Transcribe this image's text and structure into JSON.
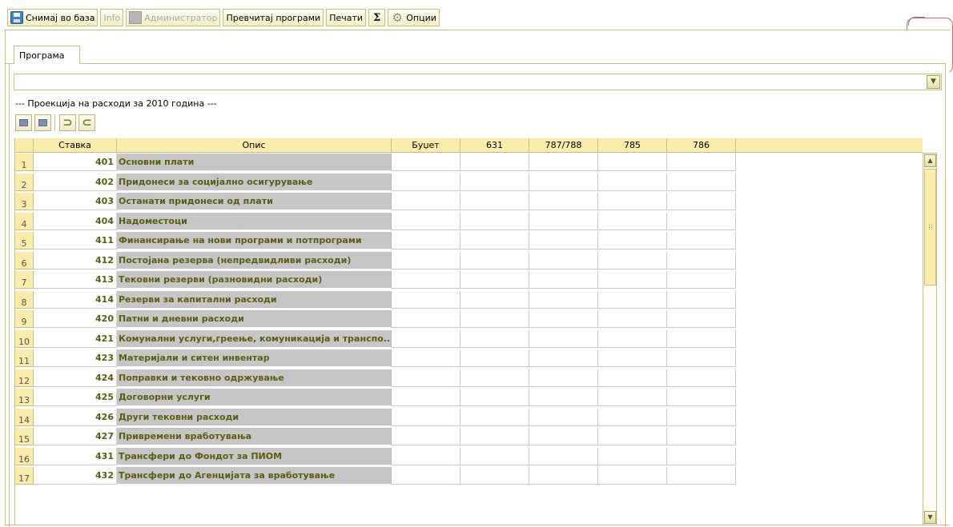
{
  "toolbar": {
    "save_label": "Снимај во база",
    "info_label": "Info",
    "admin_label": "Администратор",
    "translate_label": "Превчитај програми",
    "print_label": "Печати",
    "sigma_label": "Σ",
    "options_label": "Опции"
  },
  "tab": {
    "label": "Програма"
  },
  "program_select": {
    "value": ""
  },
  "caption": "--- Проекција на расходи за 2010 година ---",
  "colors": {
    "accent": "#c9bf7a",
    "header_bg": "#faecaa",
    "desc_bg": "#c6c6c6",
    "code_text": "#5c5c10"
  },
  "grid": {
    "columns": [
      "Ставка",
      "Опис",
      "Буџет",
      "631",
      "787/788",
      "785",
      "786"
    ],
    "rows": [
      {
        "num": "1",
        "code": "401",
        "desc": "Основни плати"
      },
      {
        "num": "2",
        "code": "402",
        "desc": "Придонеси за социјално осигурување"
      },
      {
        "num": "3",
        "code": "403",
        "desc": "Останати придонеси од плати"
      },
      {
        "num": "4",
        "code": "404",
        "desc": "Надоместоци"
      },
      {
        "num": "5",
        "code": "411",
        "desc": "Финансирање на нови програми и потпрограми"
      },
      {
        "num": "6",
        "code": "412",
        "desc": "Постојана резерва (непредвидливи расходи)"
      },
      {
        "num": "7",
        "code": "413",
        "desc": "Тековни резерви (разновидни расходи)"
      },
      {
        "num": "8",
        "code": "414",
        "desc": "Резерви за капитални расходи"
      },
      {
        "num": "9",
        "code": "420",
        "desc": "Патни и дневни расходи"
      },
      {
        "num": "10",
        "code": "421",
        "desc": "Комунални услуги,греење, комуникација и транспо..."
      },
      {
        "num": "11",
        "code": "423",
        "desc": "Материјали и ситен инвентар"
      },
      {
        "num": "12",
        "code": "424",
        "desc": "Поправки и тековно одржување"
      },
      {
        "num": "13",
        "code": "425",
        "desc": "Договорни услуги"
      },
      {
        "num": "14",
        "code": "426",
        "desc": "Други тековни расходи"
      },
      {
        "num": "15",
        "code": "427",
        "desc": "Привремени вработувања"
      },
      {
        "num": "16",
        "code": "431",
        "desc": "Трансфери до Фондот за ПИОМ"
      },
      {
        "num": "17",
        "code": "432",
        "desc": "Трансфери до Агенцијата за вработување"
      }
    ]
  }
}
